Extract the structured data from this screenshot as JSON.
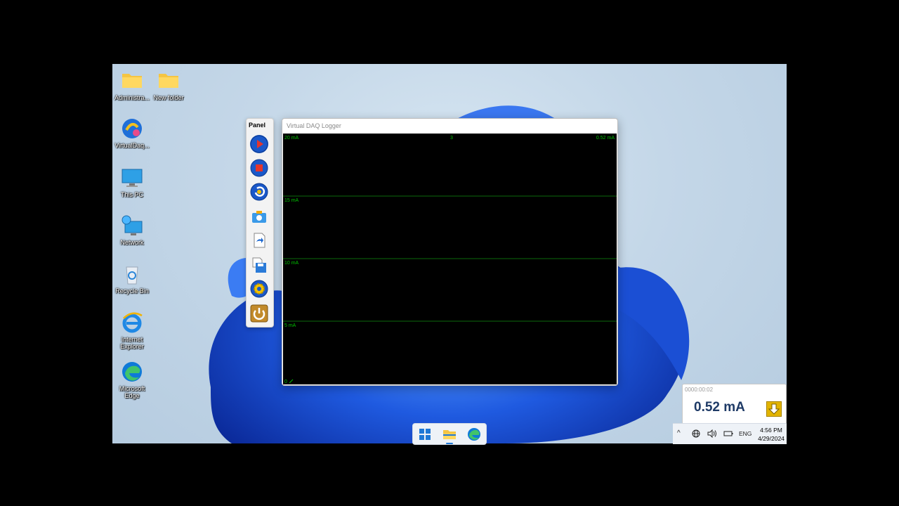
{
  "desktop_icons": [
    {
      "label": "Administra...",
      "icon": "folder-icon"
    },
    {
      "label": "New folder",
      "icon": "folder-icon"
    },
    {
      "label": "VirtualDaq...",
      "icon": "virtualdaq-app-icon"
    },
    {
      "label": "This PC",
      "icon": "monitor-icon"
    },
    {
      "label": "Network",
      "icon": "network-icon"
    },
    {
      "label": "Recycle Bin",
      "icon": "recycle-bin-icon"
    },
    {
      "label": "Internet Explorer",
      "icon": "internet-explorer-icon"
    },
    {
      "label": "Microsoft Edge",
      "icon": "edge-icon"
    }
  ],
  "panel": {
    "title": "Panel",
    "buttons": [
      "play-icon",
      "stop-icon",
      "reset-icon",
      "camera-icon",
      "open-file-icon",
      "save-icon",
      "settings-gear-icon",
      "power-icon"
    ]
  },
  "logger": {
    "title": "Virtual DAQ Logger",
    "top_center_label": "3",
    "top_right_label": "0.52 mA",
    "y_labels": [
      "20 mA",
      "15 mA",
      "10 mA",
      "5 mA",
      "0"
    ],
    "trace_color": "#00c000"
  },
  "readout": {
    "elapsed": "0000:00:02",
    "value": "0.52 mA",
    "icon": "download-arrow-icon"
  },
  "taskbar": {
    "apps": [
      "windows-start-icon",
      "file-explorer-icon",
      "edge-icon"
    ],
    "tray": {
      "chevron": "^",
      "language": "ENG",
      "time": "4:56 PM",
      "date": "4/29/2024"
    }
  }
}
